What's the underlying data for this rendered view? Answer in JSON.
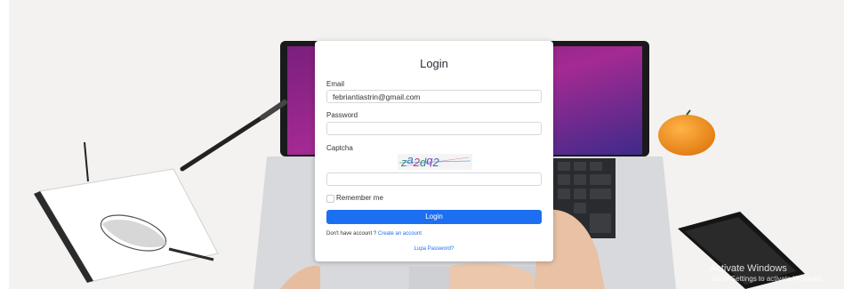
{
  "login": {
    "title": "Login",
    "email_label": "Email",
    "email_value": "febriantiastrin@gmail.com",
    "password_label": "Password",
    "password_value": "",
    "captcha_label": "Captcha",
    "captcha_text": "za2dq2",
    "captcha_value": "",
    "remember_label": "Remember me",
    "remember_checked": false,
    "submit_label": "Login",
    "signup_prompt": "Don't have account ?",
    "signup_link": "Create an account",
    "forgot_link": "Lupa Password?"
  },
  "watermark": {
    "line1": "Activate Windows",
    "line2": "Go to Settings to activate Windows."
  },
  "colors": {
    "accent": "#1d6ff2",
    "card": "#ffffff",
    "background": "#f2f1ef"
  }
}
